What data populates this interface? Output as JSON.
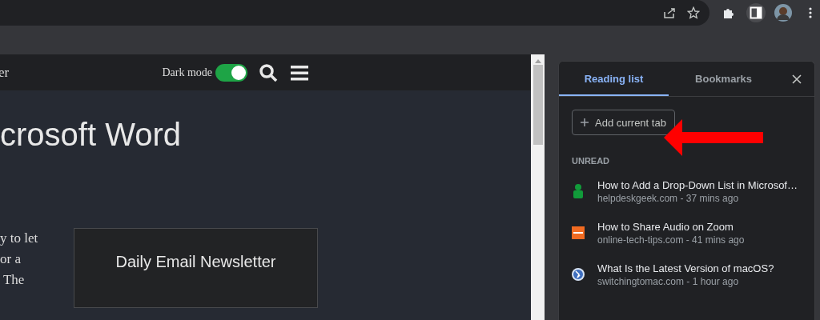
{
  "page": {
    "site_title": "er",
    "dark_mode_label": "Dark mode",
    "dark_mode_on": true,
    "heading": "crosoft Word",
    "paragraph_lines": [
      "y to let",
      "or a",
      " The"
    ],
    "newsletter_title": "Daily Email Newsletter"
  },
  "side_panel": {
    "tabs": [
      {
        "label": "Reading list",
        "selected": true
      },
      {
        "label": "Bookmarks",
        "selected": false
      }
    ],
    "add_button": "Add current tab",
    "section": "UNREAD",
    "items": [
      {
        "kind": "person",
        "title": "How to Add a Drop-Down List in Microsof…",
        "meta": "helpdeskgeek.com - 37 mins ago"
      },
      {
        "kind": "logo",
        "title": "How to Share Audio on Zoom",
        "meta": "online-tech-tips.com - 41 mins ago"
      },
      {
        "kind": "globe",
        "title": "What Is the Latest Version of macOS?",
        "meta": "switchingtomac.com - 1 hour ago"
      }
    ]
  }
}
